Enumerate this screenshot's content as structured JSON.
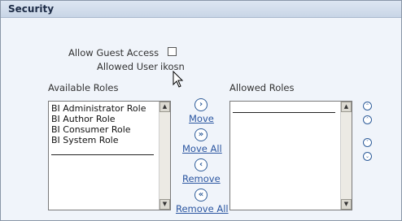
{
  "header": {
    "title": "Security"
  },
  "guest": {
    "allow_label": "Allow Guest Access",
    "allowed_user_label": "Allowed User",
    "allowed_user_value": "ikosn"
  },
  "available": {
    "label": "Available Roles",
    "items": [
      "BI Administrator Role",
      "BI Author Role",
      "BI Consumer Role",
      "BI System Role"
    ]
  },
  "allowed": {
    "label": "Allowed Roles"
  },
  "shuttle": {
    "move_label": "Move",
    "move_all_label": "Move All",
    "remove_label": "Remove",
    "remove_all_label": "Remove All"
  },
  "glyphs": {
    "move": "›",
    "move_all": "»",
    "remove": "‹",
    "remove_all": "«",
    "scroll_up": "▲",
    "scroll_down": "▼",
    "top": "⌃",
    "up": "˄",
    "down": "˅",
    "bottom": "⌄"
  },
  "icons": {
    "move": "chevron-right-icon",
    "move_all": "double-chevron-right-icon",
    "remove": "chevron-left-icon",
    "remove_all": "double-chevron-left-icon",
    "move_top": "move-to-top-icon",
    "move_up": "move-up-icon",
    "move_down": "move-down-icon",
    "move_bottom": "move-to-bottom-icon",
    "cursor": "mouse-pointer-icon"
  },
  "colors": {
    "link": "#2a55a0",
    "header_bg": "#c8d5e6",
    "panel_bg": "#f0f4fa"
  }
}
